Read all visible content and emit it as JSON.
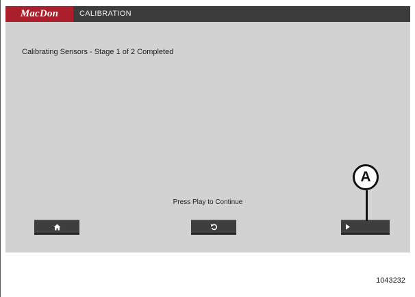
{
  "header": {
    "brand": "MacDon",
    "title": "CALIBRATION"
  },
  "main": {
    "status_message": "Calibrating Sensors - Stage 1 of 2 Completed",
    "prompt_message": "Press Play to Continue"
  },
  "buttons": {
    "home_icon": "home-icon",
    "back_icon": "back-arrow-icon",
    "play_icon": "play-icon"
  },
  "annotation": {
    "callout_label": "A"
  },
  "figure_number": "1043232",
  "colors": {
    "brand_red": "#ab1e2b",
    "titlebar": "#3c3c3c",
    "screen_background": "#d2d2d2",
    "button": "#3e3e3e"
  }
}
